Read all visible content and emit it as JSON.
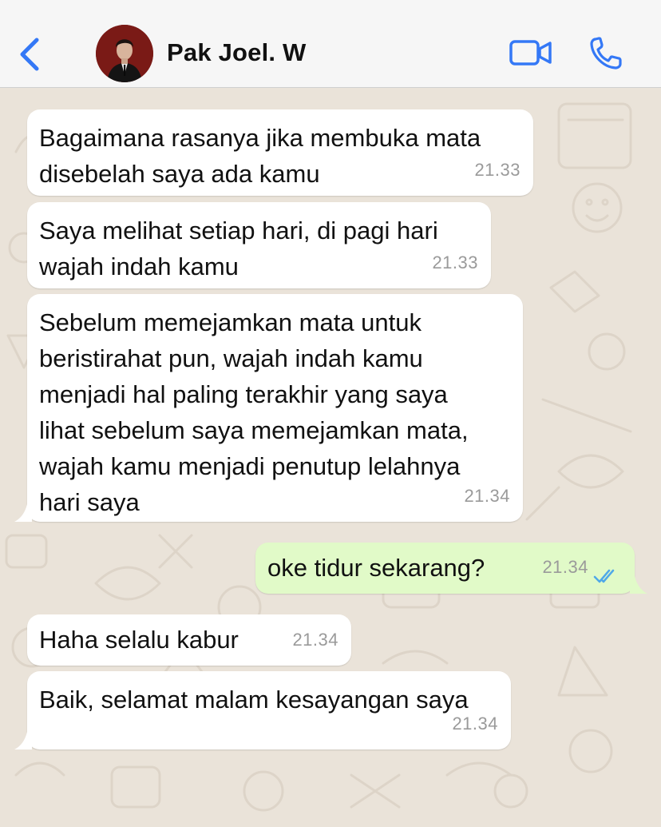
{
  "header": {
    "contact_name": "Pak Joel. W",
    "back_icon": "chevron-left-icon",
    "video_icon": "video-camera-icon",
    "call_icon": "phone-icon",
    "accent_color": "#3478F6"
  },
  "messages": [
    {
      "direction": "in",
      "text": "Bagaimana rasanya jika membuka mata\ndisebelah saya ada kamu",
      "time": "21.33"
    },
    {
      "direction": "in",
      "text": "Saya melihat setiap hari, di pagi hari\nwajah indah kamu",
      "time": "21.33"
    },
    {
      "direction": "in",
      "text": "Sebelum memejamkan mata untuk\nberistirahat pun, wajah indah kamu\nmenjadi hal paling terakhir yang saya\nlihat sebelum saya memejamkan mata,\nwajah kamu menjadi penutup lelahnya\nhari saya",
      "time": "21.34"
    },
    {
      "direction": "out",
      "text": "oke tidur sekarang?",
      "time": "21.34",
      "status": "read"
    },
    {
      "direction": "in",
      "text": "Haha selalu kabur",
      "time": "21.34"
    },
    {
      "direction": "in",
      "text": "Baik, selamat malam kesayangan saya",
      "time": "21.34"
    }
  ],
  "colors": {
    "incoming_bubble": "#FFFFFF",
    "outgoing_bubble": "#E1FAC8",
    "chat_background": "#EAE3D9",
    "read_ticks": "#4FA8E8"
  }
}
